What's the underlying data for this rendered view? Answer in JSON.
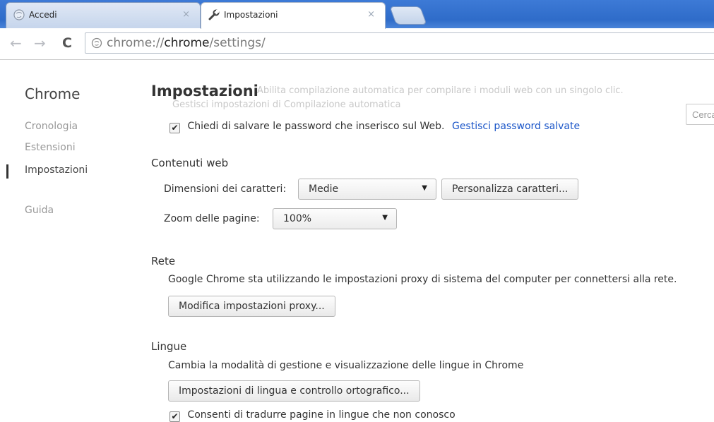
{
  "tabs": [
    {
      "title": "Accedi",
      "close": "×"
    },
    {
      "title": "Impostazioni",
      "close": "×"
    }
  ],
  "toolbar": {
    "back_glyph": "←",
    "forward_glyph": "→",
    "reload_glyph": "C",
    "url_prefix": "chrome://",
    "url_host": "chrome",
    "url_path": "/settings/"
  },
  "sidebar": {
    "brand": "Chrome",
    "items": [
      {
        "label": "Cronologia"
      },
      {
        "label": "Estensioni"
      },
      {
        "label": "Impostazioni"
      },
      {
        "label": "Guida"
      }
    ]
  },
  "main": {
    "title": "Impostazioni",
    "ghost_line1": "Abilita compilazione automatica per compilare i moduli web con un singolo clic.",
    "ghost_line2": "Gestisci impostazioni di Compilazione automatica",
    "search_placeholder": "Cerca",
    "passwords": {
      "label": "Chiedi di salvare le password che inserisco sul Web.",
      "link": "Gestisci password salvate",
      "checked": "✔"
    },
    "web_content": {
      "title": "Contenuti web",
      "font_size_label": "Dimensioni dei caratteri:",
      "font_size_value": "Medie",
      "customize_fonts_button": "Personalizza caratteri...",
      "zoom_label": "Zoom delle pagine:",
      "zoom_value": "100%",
      "arrow": "▼"
    },
    "network": {
      "title": "Rete",
      "description": "Google Chrome sta utilizzando le impostazioni proxy di sistema del computer per connettersi alla rete.",
      "proxy_button": "Modifica impostazioni proxy..."
    },
    "languages": {
      "title": "Lingue",
      "description": "Cambia la modalità di gestione e visualizzazione delle lingue in Chrome",
      "language_button": "Impostazioni di lingua e controllo ortografico...",
      "translate_label": "Consenti di tradurre pagine in lingue che non conosco",
      "checked": "✔"
    }
  },
  "colors": {
    "tabstrip": "#3d7ad6",
    "link": "#1a55c8"
  }
}
